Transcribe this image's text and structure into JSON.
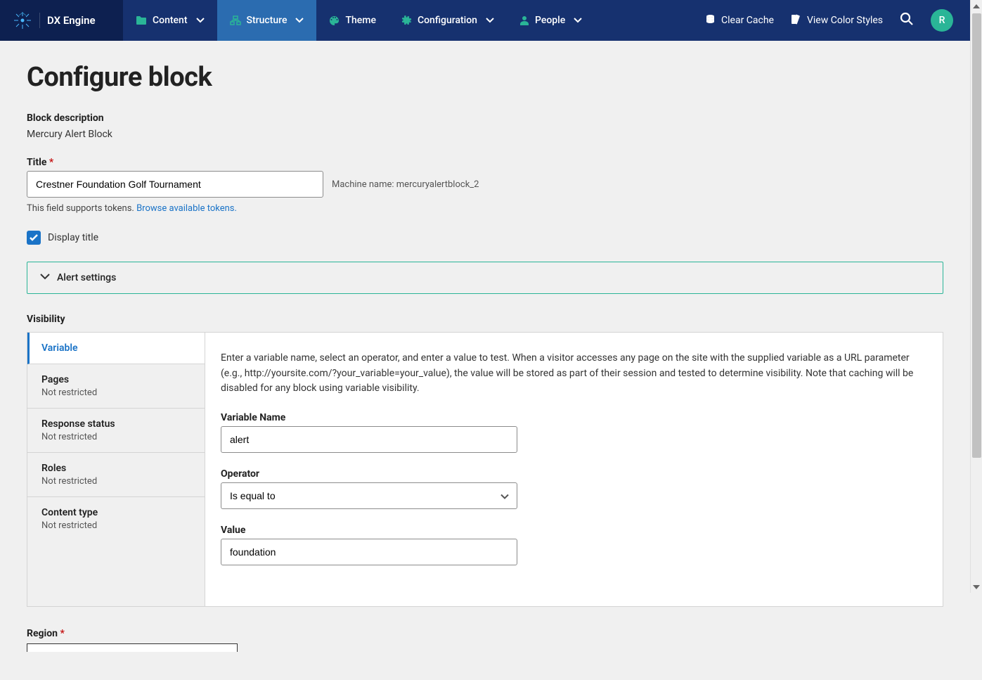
{
  "brand": "DX Engine",
  "nav": {
    "items": [
      {
        "label": "Content"
      },
      {
        "label": "Structure"
      },
      {
        "label": "Theme"
      },
      {
        "label": "Configuration"
      },
      {
        "label": "People"
      }
    ],
    "right": {
      "clear_cache": "Clear Cache",
      "view_styles": "View Color Styles",
      "avatar_initial": "R"
    }
  },
  "page": {
    "title": "Configure block",
    "block_description_label": "Block description",
    "block_description_value": "Mercury Alert Block",
    "title_label": "Title",
    "title_value": "Crestner Foundation Golf Tournament",
    "machine_name_label": "Machine name:",
    "machine_name_value": "mercuryalertblock_2",
    "tokens_hint": "This field supports tokens.",
    "tokens_link": "Browse available tokens.",
    "display_title_label": "Display title",
    "alert_settings_label": "Alert settings",
    "visibility_label": "Visibility",
    "region_label": "Region"
  },
  "vtabs": [
    {
      "title": "Variable",
      "sub": ""
    },
    {
      "title": "Pages",
      "sub": "Not restricted"
    },
    {
      "title": "Response status",
      "sub": "Not restricted"
    },
    {
      "title": "Roles",
      "sub": "Not restricted"
    },
    {
      "title": "Content type",
      "sub": "Not restricted"
    }
  ],
  "variable_panel": {
    "desc": "Enter a variable name, select an operator, and enter a value to test. When a visitor accesses any page on the site with the supplied variable as a URL parameter (e.g., http://yoursite.com/?your_variable=your_value), the value will be stored as part of their session and tested to determine visibility. Note that caching will be disabled for any block using variable visibility.",
    "var_name_label": "Variable Name",
    "var_name_value": "alert",
    "operator_label": "Operator",
    "operator_value": "Is equal to",
    "value_label": "Value",
    "value_value": "foundation"
  }
}
